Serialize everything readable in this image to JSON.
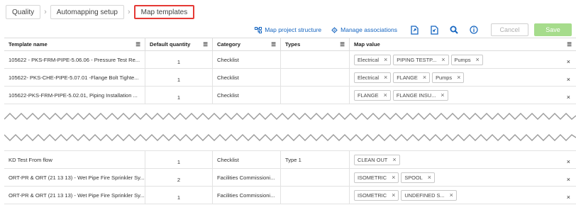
{
  "breadcrumb": [
    "Quality",
    "Automapping setup",
    "Map templates"
  ],
  "toolbar": {
    "map_project_structure": "Map project structure",
    "manage_associations": "Manage associations",
    "cancel": "Cancel",
    "save": "Save"
  },
  "columns": [
    "Template name",
    "Default quantity",
    "Category",
    "Types",
    "Map value"
  ],
  "rows_top": [
    {
      "name": "105622 - PKS-FRM-PIPE-5.06.06 - Pressure Test Re...",
      "qty": "1",
      "category": "Checklist",
      "types": "",
      "chips": [
        "Electrical",
        "PIPING TESTP...",
        "Pumps"
      ]
    },
    {
      "name": "105622- PKS-CHE-PIPE-5.07.01 -Flange Bolt Tighte...",
      "qty": "1",
      "category": "Checklist",
      "types": "",
      "chips": [
        "Electrical",
        "FLANGE",
        "Pumps"
      ]
    },
    {
      "name": "105622-PKS-FRM-PIPE-5.02.01, Piping Installation ...",
      "qty": "1",
      "category": "Checklist",
      "types": "",
      "chips": [
        "FLANGE",
        "FLANGE INSU..."
      ]
    }
  ],
  "rows_bottom": [
    {
      "name": "KD Test From flow",
      "qty": "1",
      "category": "Checklist",
      "types": "Type 1",
      "chips": [
        "CLEAN OUT"
      ]
    },
    {
      "name": "ORT-PR & ORT (21 13 13) - Wet Pipe Fire Sprinkler Sy...",
      "qty": "2",
      "category": "Facilities Commissioni...",
      "types": "",
      "chips": [
        "ISOMETRIC",
        "SPOOL"
      ]
    },
    {
      "name": "ORT-PR & ORT (21 13 13) - Wet Pipe Fire Sprinkler Sy...",
      "qty": "1",
      "category": "Facilities Commissioni...",
      "types": "",
      "chips": [
        "ISOMETRIC",
        "UNDEFINED S..."
      ]
    }
  ],
  "icons": {
    "filter": "filter-icon",
    "map_structure": "hierarchy-icon",
    "manage_assoc": "gear-icon",
    "export": "export-icon",
    "import": "import-icon",
    "search": "search-icon",
    "info": "info-icon",
    "remove": "close-icon"
  },
  "colors": {
    "accent": "#1565c0",
    "save": "#a6dc8c",
    "active_border": "#e53935"
  }
}
